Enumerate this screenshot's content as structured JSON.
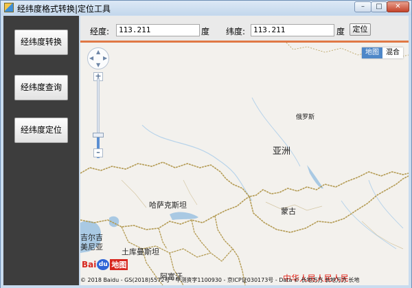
{
  "window": {
    "title": "经纬度格式转换|定位工具",
    "controls": {
      "minimize": "–",
      "maximize": "□",
      "close": "✕"
    }
  },
  "sidebar": {
    "buttons": [
      {
        "label": "经纬度转换"
      },
      {
        "label": "经纬度查询"
      },
      {
        "label": "经纬度定位"
      }
    ]
  },
  "toolbar": {
    "longitude_label": "经度:",
    "longitude_value": "113.211",
    "longitude_unit": "度",
    "latitude_label": "纬度:",
    "latitude_value": "113.211",
    "latitude_unit": "度",
    "locate_label": "定位"
  },
  "map": {
    "type_buttons": {
      "map": "地图",
      "hybrid": "混合"
    },
    "zoom": {
      "in": "+",
      "out": "–",
      "level_fraction": 0.26
    },
    "labels": {
      "russia": "俄罗斯",
      "asia": "亚洲",
      "kazakhstan": "哈萨克斯坦",
      "mongolia": "蒙古",
      "kyrgyzstan": "吉尔吉",
      "armenia": "美尼亚",
      "turkmenistan": "土库曼斯坦",
      "afghanistan": "阿富汗"
    },
    "logo": {
      "part1": "Bai",
      "paw": "du",
      "part2": "地图"
    },
    "slogan": "中华人民人民人民",
    "copyright": "© 2018 Baidu - GS(2018)5572号 - 甲测资字1100930 - 京ICP证030173号 - Data © 长地万方 长地万方 长地"
  },
  "colors": {
    "sidebar_bg": "#3d3d3d",
    "toolbar_accent": "#e07845",
    "map_bg": "#f3f1ed",
    "border_line": "#b39a52",
    "map_type_active": "#4e87c8"
  }
}
